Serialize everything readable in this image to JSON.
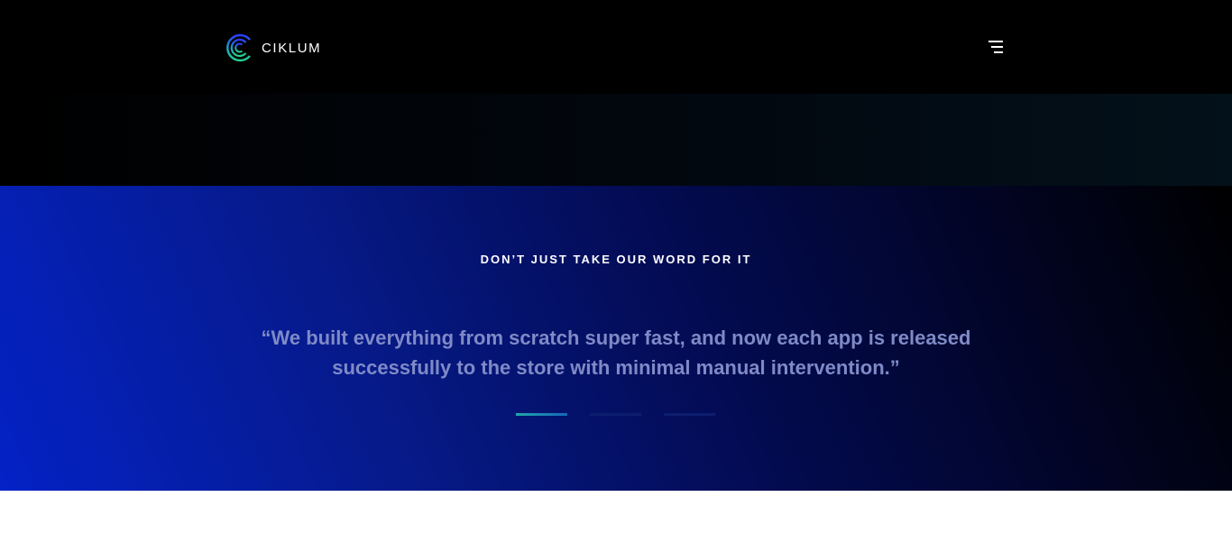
{
  "header": {
    "brand": "CIKLUM",
    "logo_icon": "ciklum-logo-icon",
    "menu_icon": "hamburger-menu-icon"
  },
  "testimonials": {
    "eyebrow": "DON’T JUST TAKE OUR WORD FOR IT",
    "quote": "“We built everything from scratch super fast, and now each app is released successfully to the store with minimal manual intervention.”",
    "slides_total": 3,
    "active_slide": 1
  },
  "colors": {
    "header_bg": "#000000",
    "gradient_start": "#0422c6",
    "gradient_end": "#000000",
    "quote_text": "#7f8ac7",
    "indicator_active": "#1fa7a8",
    "indicator_inactive": "#0d1d6e"
  }
}
